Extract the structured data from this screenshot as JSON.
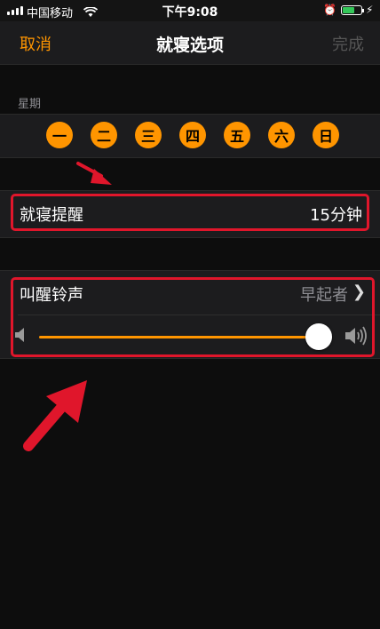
{
  "status_bar": {
    "carrier": "中国移动",
    "time": "下午9:08",
    "battery_level": 0.6,
    "signal_icon": "signal-bars-icon",
    "wifi_icon": "wifi-icon",
    "alarm_icon": "alarm-clock-icon",
    "charging_icon": "charging-bolt-icon"
  },
  "nav": {
    "cancel_label": "取消",
    "title": "就寝选项",
    "done_label": "完成"
  },
  "weekday_section": {
    "header": "星期",
    "days": [
      "一",
      "二",
      "三",
      "四",
      "五",
      "六",
      "日"
    ]
  },
  "bedtime_reminder": {
    "label": "就寝提醒",
    "value": "15分钟"
  },
  "wake_sound": {
    "label": "叫醒铃声",
    "value": "早起者",
    "volume_level": 0.95
  },
  "colors": {
    "accent": "#ff9500",
    "annotation": "#e0162b",
    "background": "#0d0d0d",
    "cell": "#1c1c1e"
  }
}
